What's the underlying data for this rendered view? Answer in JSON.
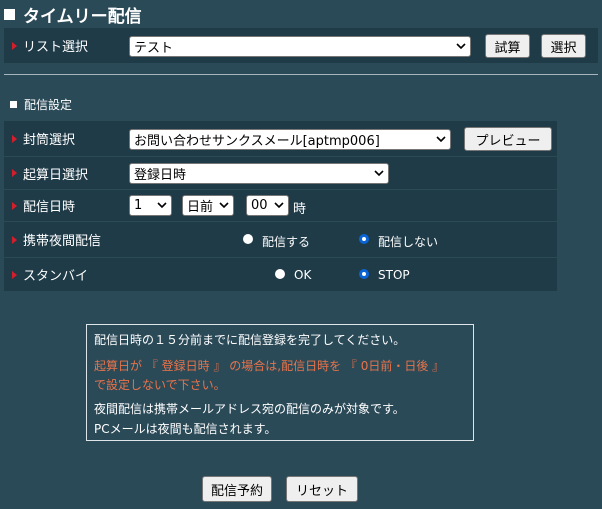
{
  "page": {
    "title": "タイムリー配信"
  },
  "list_row": {
    "label": "リスト選択",
    "selected": "テスト",
    "trial_button": "試算",
    "select_button": "選択"
  },
  "section_title": "配信設定",
  "envelope_row": {
    "label": "封筒選択",
    "selected": "お問い合わせサンクスメール[aptmp006]",
    "preview_button": "プレビュー"
  },
  "base_date_row": {
    "label": "起算日選択",
    "selected": "登録日時"
  },
  "send_time_row": {
    "label": "配信日時",
    "days_value": "1",
    "direction_value": "日前",
    "hour_value": "00",
    "hour_unit": "時"
  },
  "mobile_night_row": {
    "label": "携帯夜間配信",
    "options": [
      "配信する",
      "配信しない"
    ],
    "selected_index": 1
  },
  "standby_row": {
    "label": "スタンバイ",
    "options": [
      "OK",
      "STOP"
    ],
    "selected_index": 1
  },
  "notice": {
    "line1": "配信日時の１５分前までに配信登録を完了してください。",
    "warn_line1": "起算日が 『 登録日時 』 の場合は,配信日時を 『 0日前・日後 』",
    "warn_line2": "で設定しないで下さい。",
    "line3": "夜間配信は携帯メールアドレス宛の配信のみが対象です。",
    "line4": "PCメールは夜間も配信されます。"
  },
  "footer": {
    "reserve_button": "配信予約",
    "reset_button": "リセット"
  },
  "colors": {
    "background": "#2b4a58",
    "cell": "#1f3b48",
    "marker": "#d21f2b",
    "warning_text": "#e8734a",
    "radio_selected": "#0a64d6"
  }
}
